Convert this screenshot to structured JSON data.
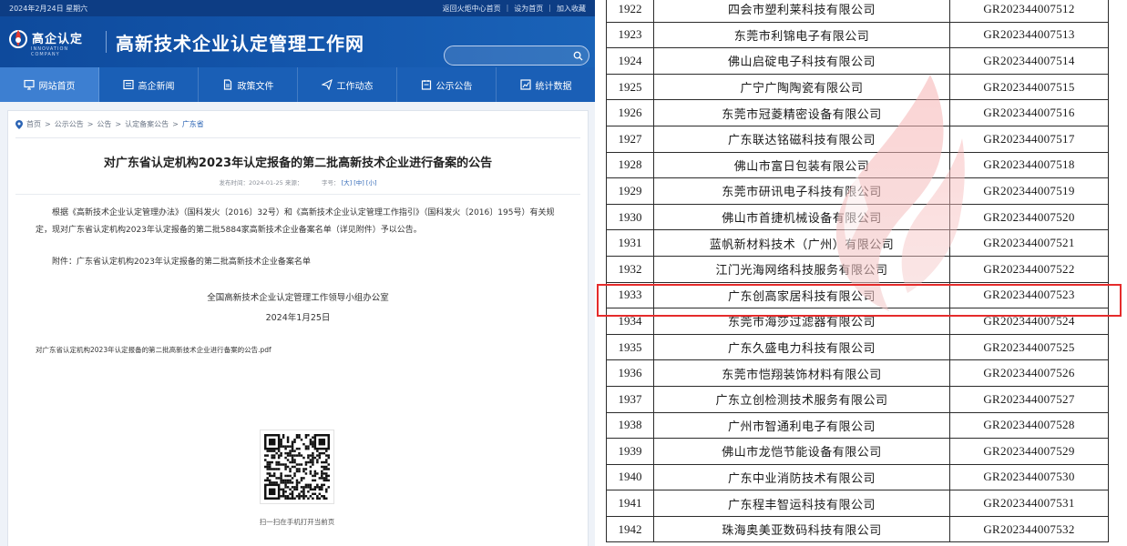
{
  "site": {
    "date": "2024年2月24日 星期六",
    "top_links": [
      "返回火炬中心首页",
      "设为首页",
      "加入收藏"
    ],
    "logo_text": "高企认定",
    "logo_en": "INNOVATION COMPANY",
    "title": "高新技术企业认定管理工作网",
    "search_placeholder": ""
  },
  "nav": [
    {
      "label": "网站首页",
      "icon": "monitor-icon",
      "active": true
    },
    {
      "label": "高企新闻",
      "icon": "news-icon",
      "active": false
    },
    {
      "label": "政策文件",
      "icon": "document-icon",
      "active": false
    },
    {
      "label": "工作动态",
      "icon": "paper-plane-icon",
      "active": false
    },
    {
      "label": "公示公告",
      "icon": "notice-icon",
      "active": false
    },
    {
      "label": "统计数据",
      "icon": "chart-icon",
      "active": false
    }
  ],
  "breadcrumb": {
    "items": [
      "首页",
      "公示公告",
      "公告",
      "认定备案公告"
    ],
    "current": "广东省",
    "separator": ">"
  },
  "article": {
    "title": "对广东省认定机构2023年认定报备的第二批高新技术企业进行备案的公告",
    "publish_label": "发布时间：",
    "publish_date": "2024-01-25",
    "source_label": "来源：",
    "font_label": "字号：",
    "font_sizes": [
      "[大]",
      "[中]",
      "[小]"
    ],
    "paragraph": "根据《高新技术企业认定管理办法》（国科发火〔2016〕32号）和《高新技术企业认定管理工作指引》（国科发火〔2016〕195号）有关规定，现对广东省认定机构2023年认定报备的第二批5884家高新技术企业备案名单（详见附件）予以公告。",
    "attachment": "附件：广东省认定机构2023年认定报备的第二批高新技术企业备案名单",
    "signature_org": "全国高新技术企业认定管理工作领导小组办公室",
    "signature_date": "2024年1月25日",
    "pdf_name": "对广东省认定机构2023年认定报备的第二批高新技术企业进行备案的公告.pdf",
    "qr_caption": "扫一扫在手机打开当前页"
  },
  "list": {
    "rows": [
      {
        "num": "1922",
        "name": "四会市塑利莱科技有限公司",
        "code": "GR202344007512"
      },
      {
        "num": "1923",
        "name": "东莞市利锦电子有限公司",
        "code": "GR202344007513"
      },
      {
        "num": "1924",
        "name": "佛山启碇电子科技有限公司",
        "code": "GR202344007514"
      },
      {
        "num": "1925",
        "name": "广宁广陶陶瓷有限公司",
        "code": "GR202344007515"
      },
      {
        "num": "1926",
        "name": "东莞市冠菱精密设备有限公司",
        "code": "GR202344007516"
      },
      {
        "num": "1927",
        "name": "广东联达铭磁科技有限公司",
        "code": "GR202344007517"
      },
      {
        "num": "1928",
        "name": "佛山市富日包装有限公司",
        "code": "GR202344007518"
      },
      {
        "num": "1929",
        "name": "东莞市研讯电子科技有限公司",
        "code": "GR202344007519"
      },
      {
        "num": "1930",
        "name": "佛山市首捷机械设备有限公司",
        "code": "GR202344007520"
      },
      {
        "num": "1931",
        "name": "蓝帆新材料技术（广州）有限公司",
        "code": "GR202344007521"
      },
      {
        "num": "1932",
        "name": "江门光海网络科技服务有限公司",
        "code": "GR202344007522"
      },
      {
        "num": "1933",
        "name": "广东创高家居科技有限公司",
        "code": "GR202344007523",
        "highlight": true
      },
      {
        "num": "1934",
        "name": "东莞市海莎过滤器有限公司",
        "code": "GR202344007524"
      },
      {
        "num": "1935",
        "name": "广东久盛电力科技有限公司",
        "code": "GR202344007525"
      },
      {
        "num": "1936",
        "name": "东莞市恺翔装饰材料有限公司",
        "code": "GR202344007526"
      },
      {
        "num": "1937",
        "name": "广东立创检测技术服务有限公司",
        "code": "GR202344007527"
      },
      {
        "num": "1938",
        "name": "广州市智通利电子有限公司",
        "code": "GR202344007528"
      },
      {
        "num": "1939",
        "name": "佛山市龙恺节能设备有限公司",
        "code": "GR202344007529"
      },
      {
        "num": "1940",
        "name": "广东中业消防技术有限公司",
        "code": "GR202344007530"
      },
      {
        "num": "1941",
        "name": "广东程丰智运科技有限公司",
        "code": "GR202344007531"
      },
      {
        "num": "1942",
        "name": "珠海奥美亚数码科技有限公司",
        "code": "GR202344007532"
      }
    ],
    "highlight_color": "#e52b2b"
  }
}
